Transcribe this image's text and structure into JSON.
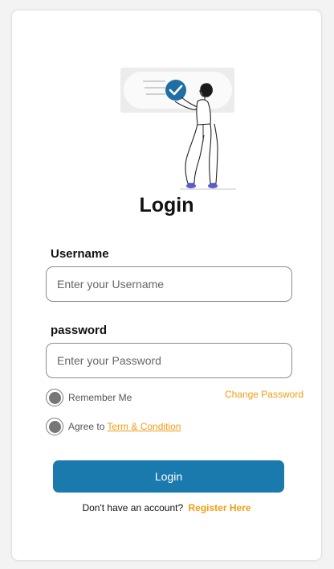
{
  "form": {
    "title": "Login",
    "username_label": "Username",
    "username_placeholder": "Enter your Username",
    "password_label": "password",
    "password_placeholder": "Enter your Password",
    "remember_label": "Remember Me",
    "change_password": "Change Password",
    "agree_prefix": "Agree to",
    "terms_link": "Term & Condition",
    "login_button": "Login",
    "footer_text": "Don't have an account?",
    "register_link": "Register Here"
  },
  "colors": {
    "primary": "#1a79ad",
    "accent": "#f39c12",
    "illustration_check": "#1f6fa3",
    "shoes": "#5b5bd6"
  },
  "icons": {
    "illustration": "person-with-checkmark-illustration",
    "check": "check-icon"
  }
}
